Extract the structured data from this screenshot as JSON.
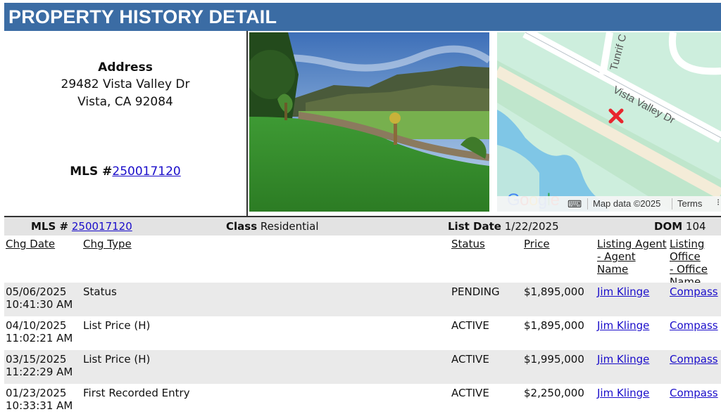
{
  "page": {
    "title": "PROPERTY HISTORY DETAIL"
  },
  "property": {
    "address_label": "Address",
    "address_line1": "29482 Vista Valley Dr",
    "address_line2": "Vista, CA 92084",
    "mls_label": "MLS #",
    "mls_number": "250017120"
  },
  "map": {
    "road_main": "Vista Valley Dr",
    "road_side": "Tunrif C",
    "logo": "Google",
    "map_data": "Map data ©2025",
    "terms": "Terms",
    "marker_icon": "location-x-marker-icon",
    "keyboard_icon": "keyboard-icon"
  },
  "summary": {
    "mls_label": "MLS #",
    "mls_number": "250017120",
    "class_label": "Class",
    "class_value": "Residential",
    "list_date_label": "List Date",
    "list_date_value": "1/22/2025",
    "dom_label": "DOM",
    "dom_value": "104"
  },
  "history": {
    "headers": {
      "chg_date": "Chg Date",
      "chg_type": "Chg Type",
      "status": "Status",
      "price": "Price",
      "agent_line1": "Listing Agent",
      "agent_line2": "- Agent",
      "agent_line3": "Name",
      "office_line1": "Listing Office",
      "office_line2": "- Office",
      "office_line3": "Name"
    },
    "rows": [
      {
        "date": "05/06/2025",
        "time": "10:41:30 AM",
        "type": "Status",
        "status": "PENDING",
        "price": "$1,895,000",
        "agent": "Jim Klinge",
        "office": "Compass"
      },
      {
        "date": "04/10/2025",
        "time": "11:02:21 AM",
        "type": "List Price (H)",
        "status": "ACTIVE",
        "price": "$1,895,000",
        "agent": "Jim Klinge",
        "office": "Compass"
      },
      {
        "date": "03/15/2025",
        "time": "11:22:29 AM",
        "type": "List Price (H)",
        "status": "ACTIVE",
        "price": "$1,995,000",
        "agent": "Jim Klinge",
        "office": "Compass"
      },
      {
        "date": "01/23/2025",
        "time": "10:33:31 AM",
        "type": "First Recorded Entry",
        "status": "ACTIVE",
        "price": "$2,250,000",
        "agent": "Jim Klinge",
        "office": "Compass"
      }
    ]
  },
  "colors": {
    "banner": "#3b6ca4",
    "link": "#1a0dca",
    "row_alt": "#eaeaea",
    "summary_bg": "#e3e3e3"
  }
}
